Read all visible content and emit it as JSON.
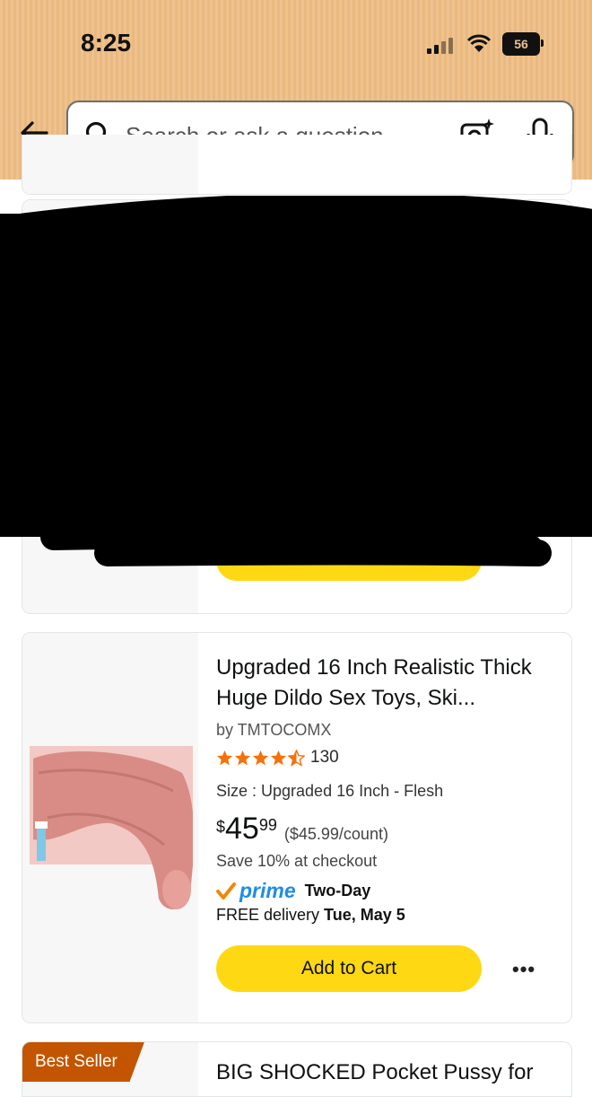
{
  "status_bar": {
    "time": "8:25",
    "battery": "56"
  },
  "search": {
    "placeholder": "Search or ask a question"
  },
  "colors": {
    "header_bg": "#efc28e",
    "add_to_cart": "#ffd814",
    "star": "#f5720b",
    "prime_blue": "#1f8ce6",
    "best_seller_badge": "#c45500"
  },
  "icons": {
    "back": "back-arrow-icon",
    "search": "search-icon",
    "camera": "camera-search-icon",
    "mic": "microphone-icon",
    "more": "more-options-icon"
  },
  "results": {
    "redacted_item": {
      "add_to_cart_label": ""
    },
    "main_item": {
      "title": "Upgraded 16 Inch Realistic Thick Huge Dildo Sex Toys, Ski...",
      "brand": "by TMTOCOMX",
      "rating": 4.5,
      "rating_count": "130",
      "size": "Size : Upgraded 16 Inch - Flesh",
      "price_symbol": "$",
      "price_whole": "45",
      "price_fraction": "99",
      "unit_price": "($45.99/count)",
      "save_text": "Save 10% at checkout",
      "prime_label": "prime",
      "prime_speed": "Two-Day",
      "delivery_prefix": "FREE delivery",
      "delivery_date": "Tue, May 5",
      "add_to_cart_label": "Add to Cart",
      "more_label": "•••"
    },
    "next_item": {
      "badge": "Best Seller",
      "title": "BIG SHOCKED Pocket Pussy for"
    }
  }
}
